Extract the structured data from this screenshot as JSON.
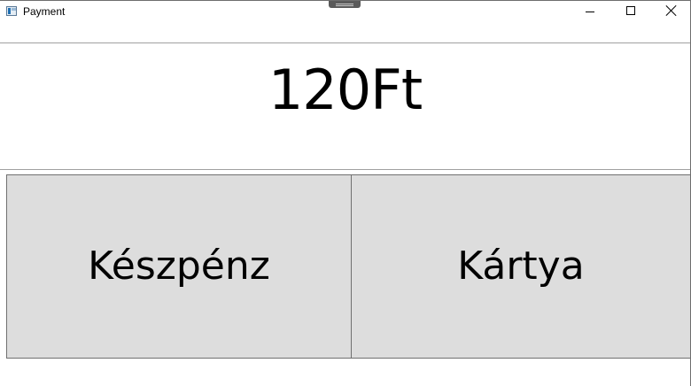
{
  "window": {
    "title": "Payment",
    "icon": "app-window-icon"
  },
  "caption_buttons": {
    "minimize": "minimize-icon",
    "maximize": "maximize-icon",
    "close": "close-icon"
  },
  "payment": {
    "amount": "120Ft",
    "cash_label": "Készpénz",
    "card_label": "Kártya"
  },
  "colors": {
    "button_bg": "#dddddd",
    "button_border": "#707070",
    "separator": "#a0a0a0"
  }
}
